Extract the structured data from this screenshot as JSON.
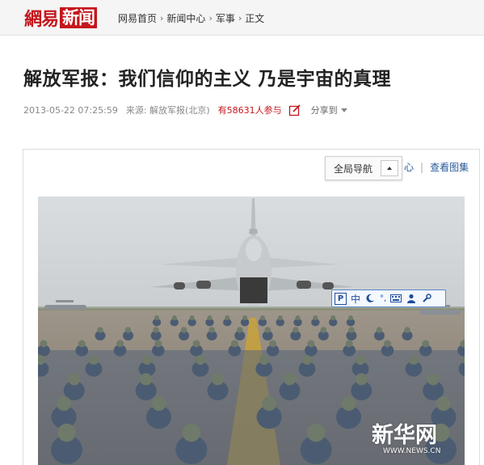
{
  "header": {
    "logo_part1": "網易",
    "logo_part2": "新闻",
    "breadcrumb": [
      "网易首页",
      "新闻中心",
      "军事",
      "正文"
    ],
    "separator": "›"
  },
  "article": {
    "title": "解放军报：我们信仰的主义  乃是宇宙的真理",
    "datetime": "2013-05-22 07:25:59",
    "source": "来源: 解放军报(北京)",
    "participants": "有58631人参与",
    "share_label": "分享到"
  },
  "gallery": {
    "nav_label": "全局导航",
    "link_partial": "心",
    "link_separator": "|",
    "view_gallery": "查看图集",
    "watermark": "新华网",
    "watermark_url": "WWW.NEWS.CN"
  },
  "ime_toolbar": {
    "mode_label": "中",
    "punct_label": "°,",
    "icons": [
      "p-logo-icon",
      "moon-icon",
      "keyboard-icon",
      "user-icon",
      "wrench-icon"
    ]
  },
  "colors": {
    "brand_red": "#c4161c",
    "link_blue": "#2a5a9a"
  }
}
